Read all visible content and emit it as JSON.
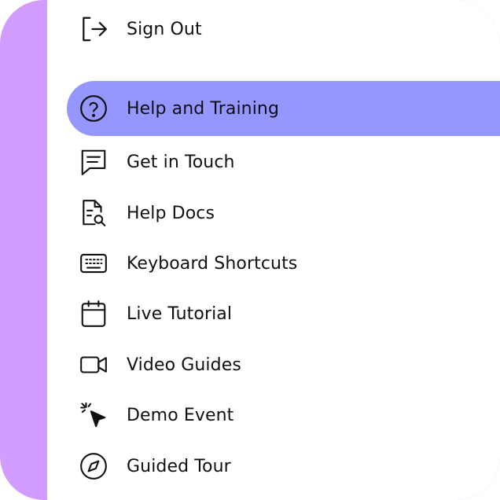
{
  "menu": {
    "sign_out": {
      "label": "Sign Out",
      "icon": "sign-out-icon"
    },
    "help_training": {
      "label": "Help and Training",
      "icon": "question-circle-icon",
      "active": true
    },
    "items": [
      {
        "label": "Get in Touch",
        "icon": "chat-bubble-icon"
      },
      {
        "label": "Help Docs",
        "icon": "doc-search-icon"
      },
      {
        "label": "Keyboard Shortcuts",
        "icon": "keyboard-icon"
      },
      {
        "label": "Live Tutorial",
        "icon": "calendar-icon"
      },
      {
        "label": "Video Guides",
        "icon": "video-camera-icon"
      },
      {
        "label": "Demo Event",
        "icon": "cursor-click-icon"
      },
      {
        "label": "Guided Tour",
        "icon": "compass-icon"
      }
    ]
  },
  "colors": {
    "accent": "#9597ff",
    "sidebar": "#d39cff",
    "text": "#0f0f14"
  }
}
